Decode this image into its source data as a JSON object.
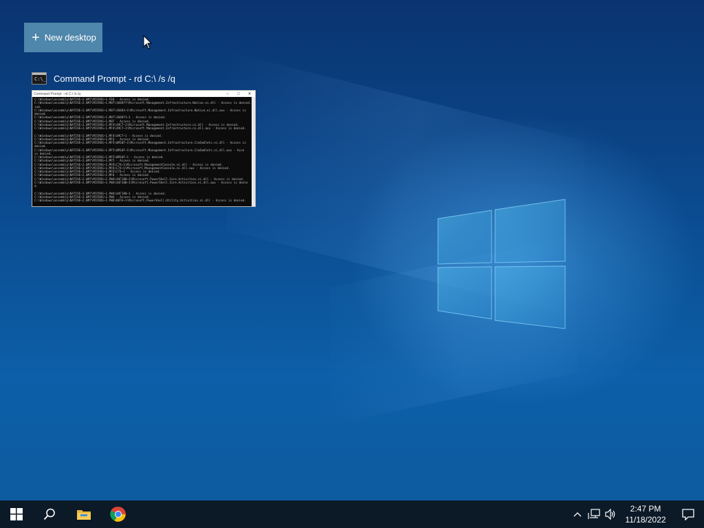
{
  "task_view": {
    "new_desktop_label": "New desktop",
    "window": {
      "title": "Command Prompt - rd  C:\\ /s /q",
      "thumbnail_title": "Command Prompt - rd  C:\\ /s /q",
      "icon_glyph": "C:\\_",
      "console_lines": [
        "C:\\Windows\\assembly\\NATIVE~2.0M7\\MICROS~1.FE0 - Access is denied.",
        "C:\\Windows\\assembly\\NATIVE~2.0M7\\MICROS~1.M07\\3848ff\\Microsoft.Management.Infrastructure.Native.ni.dll - Access is denied.",
        "ied.",
        "C:\\Windows\\assembly\\NATIVE~2.0M7\\MICROS~1.M07\\38483~1\\Microsoft.Management.Infrastructure.Native.ni.dll.aux - Access is",
        "denied.",
        "C:\\Windows\\assembly\\NATIVE~2.0M7\\MICROS~1.M07\\3848f1~1 - Access is denied.",
        "C:\\Windows\\assembly\\NATIVE~2.0M7\\MICROS~1.M07 - Access is denied.",
        "C:\\Windows\\assembly\\NATIVE~2.0M7\\MICROS~1.MF4\\49C7~1\\Microsoft.Management.Infrastructure.ni.dll - Access is denied.",
        "C:\\Windows\\assembly\\NATIVE~2.0M7\\MICROS~1.MF4\\49C7~1\\Microsoft.Management.Infrastructure.ni.dll.aux - Access is denied.",
        "",
        "C:\\Windows\\assembly\\NATIVE~2.0M7\\MICROS~1.MF4\\49C7~1 - Access is denied.",
        "C:\\Windows\\assembly\\NATIVE~2.0M7\\MICROS~1.MF4 - Access is denied.",
        "C:\\Windows\\assembly\\NATIVE~2.0M7\\MICROS~1.MF5\\0M10F~1\\Microsoft.Management.Infrastructure.CimCmdlets.ni.dll - Access is",
        "denied.",
        "C:\\Windows\\assembly\\NATIVE~2.0M7\\MICROS~1.MF5\\0M10F~1\\Microsoft.Management.Infrastructure.CimCmdlets.ni.dll.aux - Acce",
        "ss denied.",
        "C:\\Windows\\assembly\\NATIVE~2.0M7\\MICROS~1.MF5\\0M10F~1 - Access is denied.",
        "C:\\Windows\\assembly\\NATIVE~2.0M7\\MICROS~1.MF5 - Access is denied.",
        "C:\\Windows\\assembly\\NATIVE~2.0M7\\MICROS~1.MF6\\C74~1\\Microsoft.ManagementConsole.ni.dll - Access is denied.",
        "C:\\Windows\\assembly\\NATIVE~2.0M7\\MICROS~1.MF6\\C74~1\\Microsoft.ManagementConsole.ni.dll.aux - Access is denied.",
        "C:\\Windows\\assembly\\NATIVE~2.0M7\\MICROS~1.MF6\\C74~1 - Access is denied.",
        "C:\\Windows\\assembly\\NATIVE~2.0M7\\MICROS~1.MF6 - Access is denied.",
        "C:\\Windows\\assembly\\NATIVE~2.0M7\\MICROS~1.PW4\\4AF180~1\\Microsoft.PowerShell.Core.Activities.ni.dll - Access is denied.",
        "C:\\Windows\\assembly\\NATIVE~2.0M7\\MICROS~1.PW4\\4AF180~1\\Microsoft.PowerShell.Core.Activities.ni.dll.aux - Access is denie",
        "d.",
        "",
        "C:\\Windows\\assembly\\NATIVE~2.0M7\\MICROS~1.PW4\\4AF180~1 - Access is denied.",
        "C:\\Windows\\assembly\\NATIVE~2.0M7\\MICROS~1.PW4 - Access is denied.",
        "C:\\Windows\\assembly\\NATIVE~2.0M7\\MICROS~1.PW6\\B87A~1\\Microsoft.PowerShell.Utility.Activities.ni.dll - Access is denied."
      ]
    }
  },
  "taskbar": {
    "pinned": [
      {
        "name": "start-button",
        "icon": "windows-logo-icon"
      },
      {
        "name": "search-button",
        "icon": "search-icon"
      },
      {
        "name": "file-explorer-button",
        "icon": "folder-icon"
      },
      {
        "name": "chrome-button",
        "icon": "chrome-icon"
      }
    ],
    "clock": {
      "time": "2:47 PM",
      "date": "11/18/2022"
    },
    "tray_icons": [
      "chevron-up-icon",
      "network-icon",
      "volume-icon"
    ],
    "notification_icon": "action-center-icon"
  },
  "colors": {
    "taskbar_bg": "#0c1a28",
    "new_desktop_bg": "#4f86ab",
    "console_bg": "#0c0c0c"
  }
}
